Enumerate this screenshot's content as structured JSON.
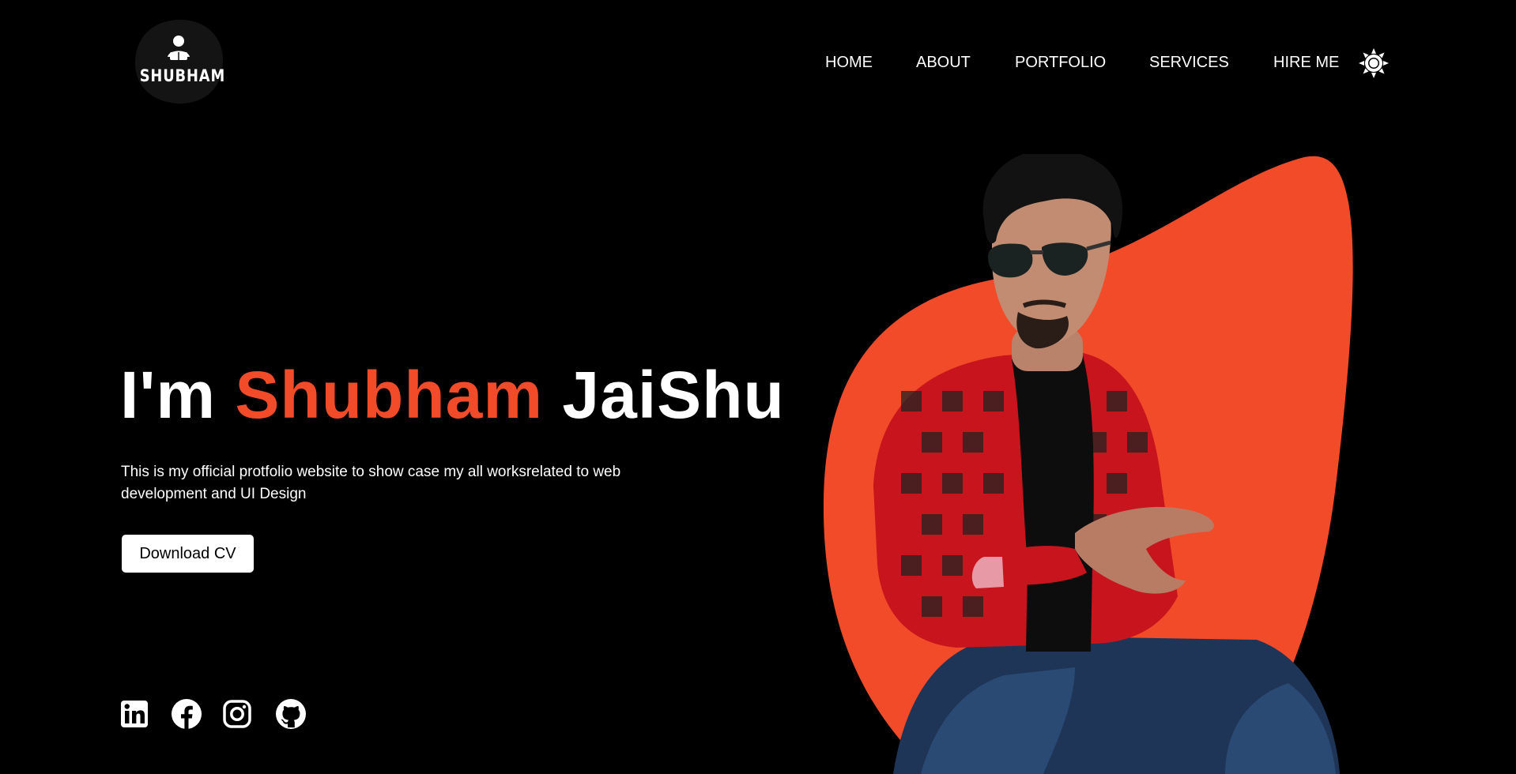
{
  "logo": {
    "text": "SHUBHAM"
  },
  "nav": {
    "items": [
      {
        "label": "HOME"
      },
      {
        "label": "ABOUT"
      },
      {
        "label": "PORTFOLIO"
      },
      {
        "label": "SERVICES"
      },
      {
        "label": "HIRE ME"
      }
    ],
    "theme_icon": "sun-icon"
  },
  "hero": {
    "title_prefix": "I'm",
    "title_accent": "Shubham",
    "title_suffix": "JaiShu",
    "description": "This is my official protfolio website to show case my all worksrelated to web development and UI Design",
    "cv_button": "Download CV"
  },
  "social": [
    {
      "icon": "linkedin-icon"
    },
    {
      "icon": "facebook-icon"
    },
    {
      "icon": "instagram-icon"
    },
    {
      "icon": "github-icon"
    }
  ],
  "colors": {
    "background": "#000000",
    "accent": "#f24b2a",
    "text": "#ffffff",
    "button_bg": "#ffffff",
    "button_text": "#000000"
  }
}
